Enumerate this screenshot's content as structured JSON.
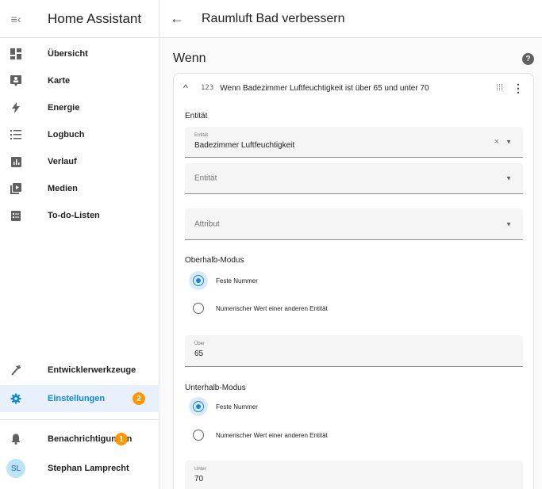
{
  "sidebar": {
    "title": "Home Assistant",
    "items": [
      {
        "label": "Übersicht"
      },
      {
        "label": "Karte"
      },
      {
        "label": "Energie"
      },
      {
        "label": "Logbuch"
      },
      {
        "label": "Verlauf"
      },
      {
        "label": "Medien"
      },
      {
        "label": "To-do-Listen"
      }
    ],
    "dev_tools": "Entwicklerwerkzeuge",
    "settings": {
      "label": "Einstellungen",
      "badge": "2"
    },
    "notifications": {
      "label": "Benachrichtigungen",
      "badge": "1"
    },
    "user": {
      "initials": "SL",
      "name": "Stephan Lamprecht"
    }
  },
  "header": {
    "title": "Raumluft Bad verbessern"
  },
  "section": {
    "title": "Wenn",
    "help": "?"
  },
  "condition": {
    "number_icon": "123",
    "headline": "Wenn Badezimmer Luftfeuchtigkeit ist über 65 und unter 70",
    "entity_section_label": "Entität",
    "entity_field": {
      "label": "Entität",
      "value": "Badezimmer Luftfeuchtigkeit"
    },
    "entity_field_2": {
      "placeholder": "Entität"
    },
    "attribute_field": {
      "placeholder": "Attribut"
    },
    "above_mode": {
      "label": "Oberhalb-Modus",
      "options": [
        "Feste Nummer",
        "Numerischer Wert einer anderen Entität"
      ],
      "selected": "Feste Nummer"
    },
    "above_field": {
      "label": "Über",
      "value": "65"
    },
    "below_mode": {
      "label": "Unterhalb-Modus",
      "options": [
        "Feste Nummer",
        "Numerischer Wert einer anderen Entität"
      ],
      "selected": "Feste Nummer"
    },
    "below_field": {
      "label": "Unter",
      "value": "70"
    }
  },
  "colors": {
    "accent": "#0e88d8",
    "badge": "#ff9800",
    "active_bg": "#e8f1fb"
  }
}
